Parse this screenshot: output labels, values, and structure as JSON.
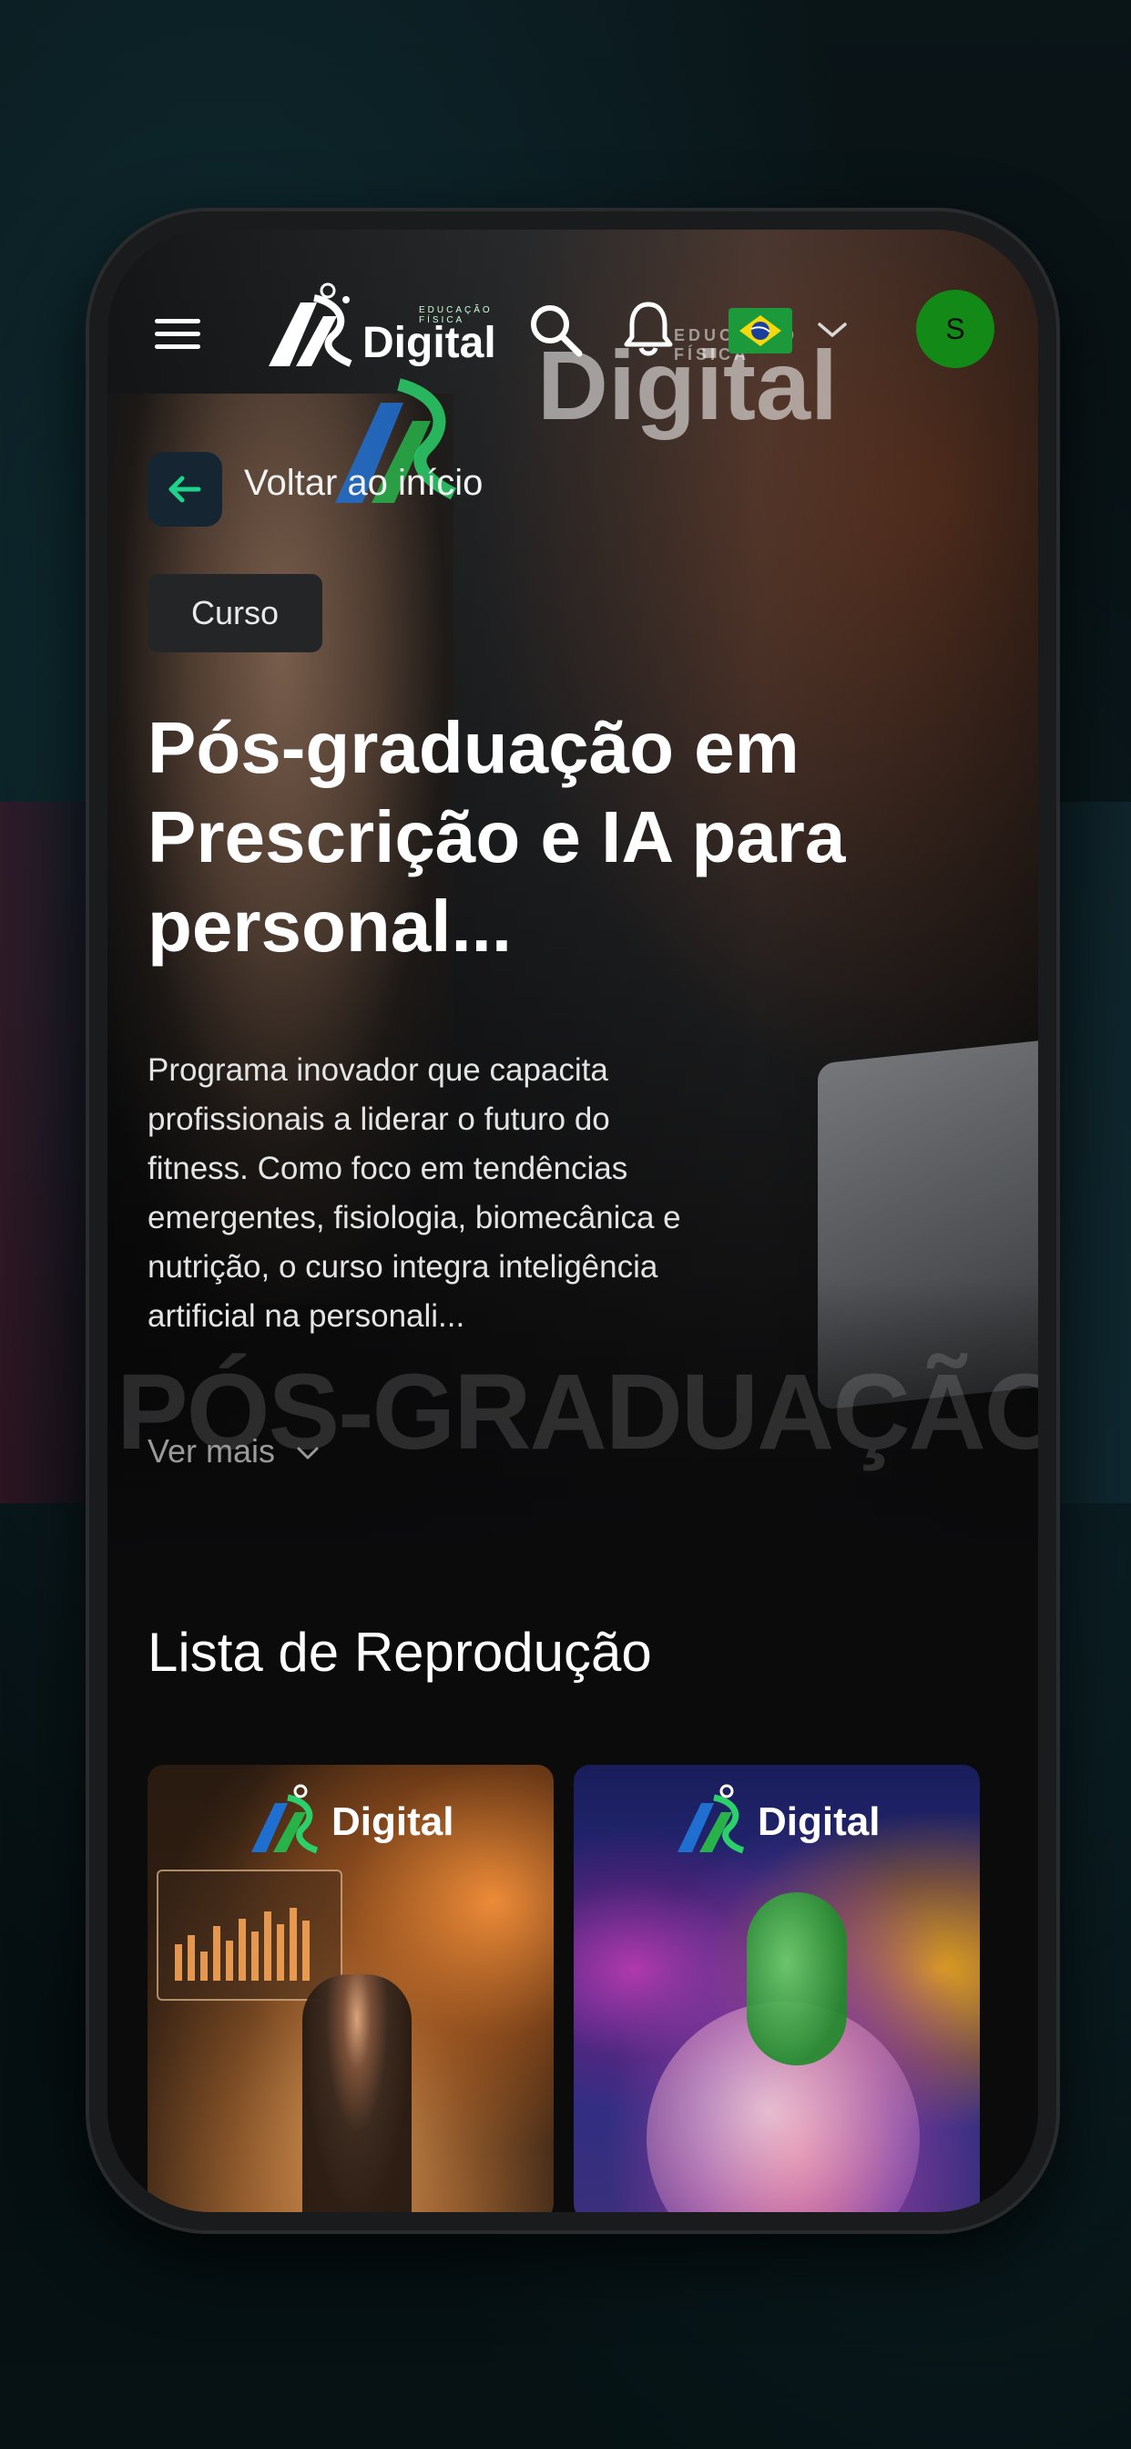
{
  "app": {
    "brand_name": "Digital",
    "brand_subtitle": "EDUCAÇÃO FÍSICA",
    "watermark_subtitle": "EDUCAÇÃO FÍSICA"
  },
  "header": {
    "menu_icon": "hamburger-menu-icon",
    "search_icon": "search-icon",
    "notifications_icon": "bell-icon",
    "language_flag": "brazil-flag-icon",
    "language_dropdown_icon": "chevron-down-icon",
    "avatar_initial": "S",
    "avatar_color": "#138a17"
  },
  "nav": {
    "back_label": "Voltar ao início",
    "back_icon": "arrow-left-icon"
  },
  "course": {
    "badge": "Curso",
    "title": "Pós-graduação em Prescrição e IA para personal...",
    "description": "Programa inovador que capacita profissionais a liderar o futuro do fitness. Como foco em tendências emergentes, fisiologia, biomecânica e nutrição, o curso integra inteligência artificial na personali...",
    "see_more": "Ver mais",
    "banner_watermark": "PÓS-GRADUAÇÃO EM"
  },
  "playlist": {
    "title": "Lista de Reprodução",
    "cards": [
      {
        "logo_text": "Digital"
      },
      {
        "logo_text": "Digital"
      }
    ]
  },
  "colors": {
    "accent": "#1fd38a",
    "back_button_bg": "#152531",
    "badge_bg": "#242526"
  }
}
